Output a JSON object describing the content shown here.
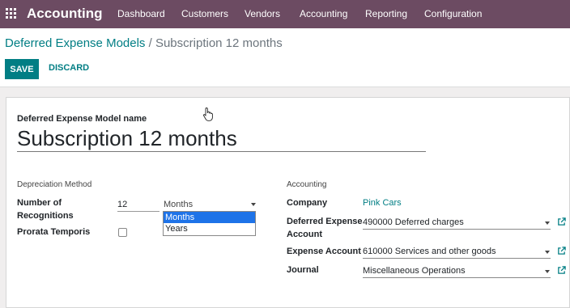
{
  "navbar": {
    "app_name": "Accounting",
    "menu": [
      "Dashboard",
      "Customers",
      "Vendors",
      "Accounting",
      "Reporting",
      "Configuration"
    ]
  },
  "breadcrumb": {
    "parent": "Deferred Expense Models",
    "separator": "/",
    "current": "Subscription 12 months"
  },
  "buttons": {
    "save": "SAVE",
    "discard": "DISCARD"
  },
  "form": {
    "name_label": "Deferred Expense Model name",
    "name_value": "Subscription 12 months",
    "depreciation": {
      "title": "Depreciation Method",
      "recognitions_label_1": "Number of",
      "recognitions_label_2": "Recognitions",
      "recognitions_value": "12",
      "period_value": "Months",
      "period_options": [
        "Months",
        "Years"
      ],
      "prorata_label": "Prorata Temporis",
      "prorata_checked": false
    },
    "accounting": {
      "title": "Accounting",
      "company_label": "Company",
      "company_value": "Pink Cars",
      "deferred_label_1": "Deferred Expense",
      "deferred_label_2": "Account",
      "deferred_value": "490000 Deferred charges",
      "expense_label": "Expense Account",
      "expense_value": "610000 Services and other goods",
      "journal_label": "Journal",
      "journal_value": "Miscellaneous Operations"
    }
  },
  "colors": {
    "navbar": "#6c4b62",
    "primary": "#017e84",
    "selection": "#1e73e8"
  }
}
